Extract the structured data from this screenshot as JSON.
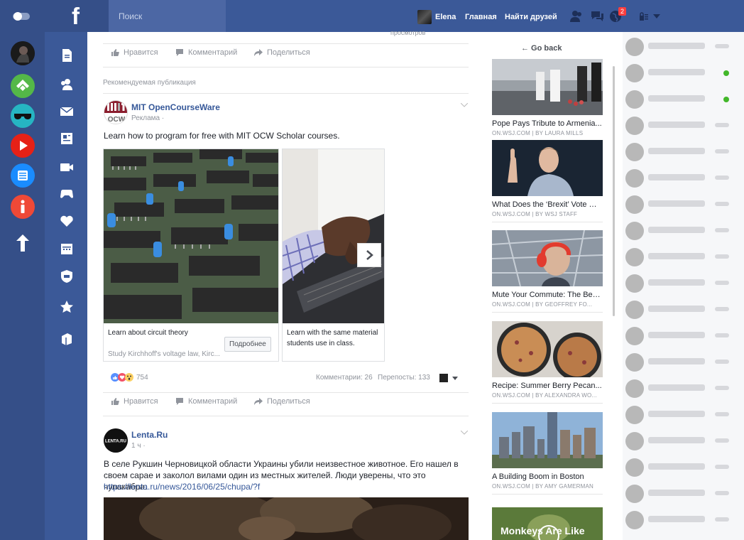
{
  "topbar": {
    "logo": "f",
    "search_placeholder": "Поиск",
    "user_name": "Elena",
    "home": "Главная",
    "find_friends": "Найти друзей",
    "notifications_count": "2"
  },
  "feed": {
    "prev_post": {
      "views_label": "просмотров",
      "like": "Нравится",
      "comment": "Комментарий",
      "share": "Поделиться"
    },
    "suggested_label": "Рекомендуемая публикация",
    "ad_post": {
      "author": "MIT OpenCourseWare",
      "logo_text": "MIT OCW",
      "subtitle": "Реклама ·",
      "text": "Learn how to program for free with MIT OCW Scholar courses.",
      "cards": [
        {
          "title": "Learn about circuit theory",
          "desc": "Study Kirchhoff's voltage law, Kirc...",
          "button": "Подробнее"
        },
        {
          "title": "Learn with the same material students use in class.",
          "desc": "",
          "button": ""
        }
      ],
      "reactions_count": "754",
      "comments": "Комментарии: 26",
      "reposts": "Перепосты: 133",
      "like": "Нравится",
      "comment": "Комментарий",
      "share": "Поделиться"
    },
    "lenta_post": {
      "author": "Lenta.Ru",
      "logo_text": "LENTA.RU",
      "subtitle": "1 ч ·",
      "text": "В селе Рукшин Черновицкой области Украины убили неизвестное животное. Его нашел в своем сарае и заколол вилами один из местных жителей. Люди уверены, что это чупакабра:",
      "link": "https://lenta.ru/news/2016/06/25/chupa/?f"
    }
  },
  "wsj": {
    "back": "← Go back",
    "items": [
      {
        "title": "Pope Pays Tribute to Armenia...",
        "meta": "ON.WSJ.COM | BY LAURA MILLS"
      },
      {
        "title": "What Does the ‘Brexit’ Vote Mean...",
        "meta": "ON.WSJ.COM | BY WSJ STAFF"
      },
      {
        "title": "Mute Your Commute: The Best...",
        "meta": "ON.WSJ.COM | BY GEOFFREY FO..."
      },
      {
        "title": "Recipe: Summer Berry Pecan...",
        "meta": "ON.WSJ.COM | BY ALEXANDRA WO..."
      },
      {
        "title": "A Building Boom in Boston",
        "meta": "ON.WSJ.COM | BY AMY GAMERMAN"
      },
      {
        "title": "Monkeys Are Like",
        "meta": ""
      }
    ]
  }
}
